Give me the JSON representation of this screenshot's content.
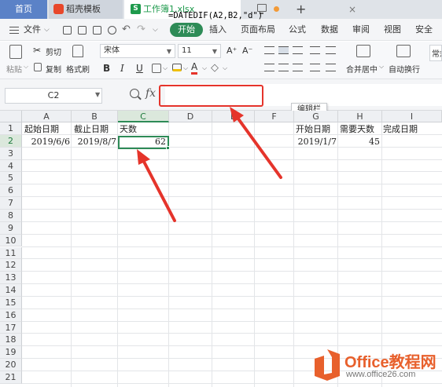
{
  "tabs": {
    "home": "首页",
    "docer": "稻壳模板",
    "workbook": "工作簿1.xlsx"
  },
  "menu": {
    "file": "文件",
    "items": [
      "开始",
      "插入",
      "页面布局",
      "公式",
      "数据",
      "审阅",
      "视图",
      "安全"
    ]
  },
  "ribbon": {
    "paste": "粘贴",
    "cut": "剪切",
    "copy": "复制",
    "format_painter": "格式刷",
    "font_name": "宋体",
    "font_size": "11",
    "bold": "B",
    "italic": "I",
    "underline": "U",
    "font_grow": "A⁺",
    "font_shrink": "A⁻",
    "merge_center": "合并居中",
    "wrap_text": "自动换行",
    "number_format": "常规"
  },
  "formula_bar": {
    "cell_ref": "C2",
    "fx": "fx",
    "formula": "=DATEDIF(A2,B2,\"d\")",
    "tooltip": "编辑栏"
  },
  "sheet": {
    "columns": [
      "A",
      "B",
      "C",
      "D",
      "E",
      "F",
      "G",
      "H",
      "I"
    ],
    "rows": [
      "1",
      "2",
      "3",
      "4",
      "5",
      "6",
      "7",
      "8",
      "9",
      "10",
      "11",
      "12",
      "13",
      "14",
      "15",
      "16",
      "17",
      "18",
      "19",
      "20",
      "21"
    ],
    "cells": {
      "A1": "起始日期",
      "B1": "截止日期",
      "C1": "天数",
      "A2": "2019/6/6",
      "B2": "2019/8/7",
      "C2": "62",
      "G1": "开始日期",
      "H1": "需要天数",
      "I1": "完成日期",
      "G2": "2019/1/7",
      "H2": "45"
    },
    "selected_cell": "C2"
  },
  "watermark": {
    "name": "Office教程网",
    "url": "www.office26.com"
  },
  "colors": {
    "accent_green": "#2e8b57",
    "annotation_red": "#e5342b",
    "logo_orange": "#e8602c"
  }
}
